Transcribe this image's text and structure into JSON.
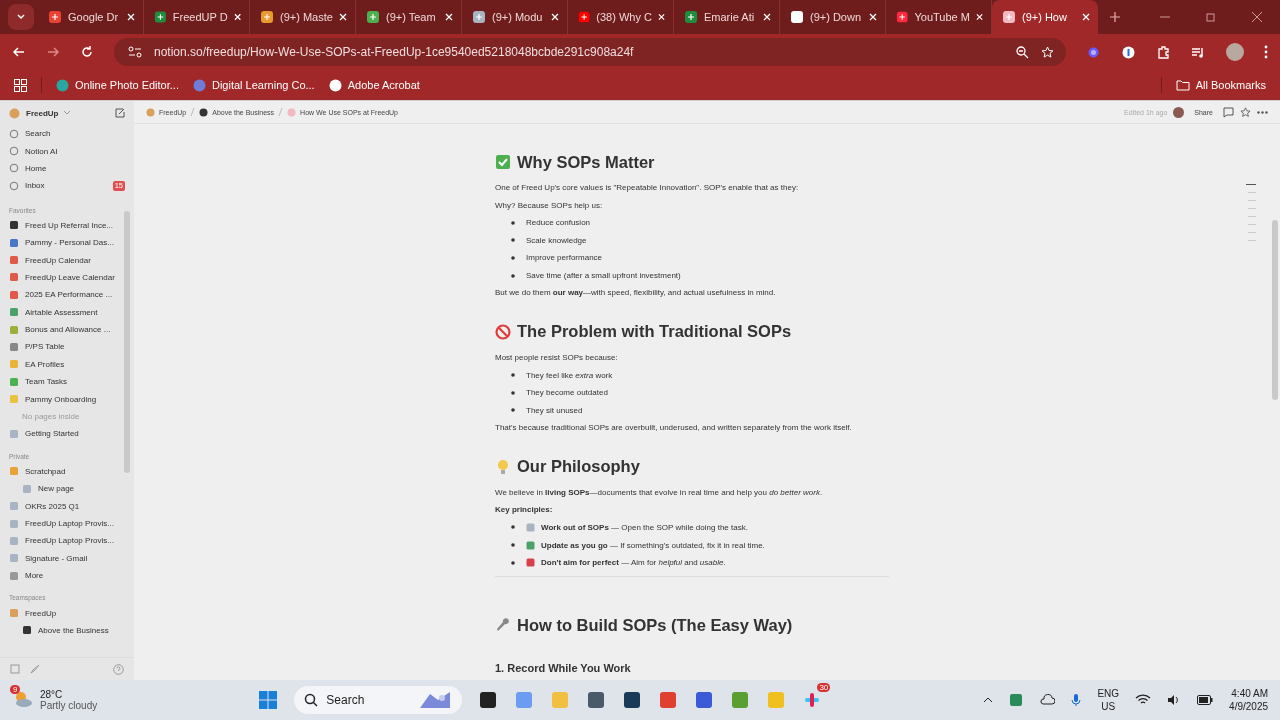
{
  "browser": {
    "tabs": [
      {
        "title": "Google Dr",
        "selected": false
      },
      {
        "title": "FreedUP D",
        "selected": false
      },
      {
        "title": "(9+) Maste",
        "selected": false
      },
      {
        "title": "(9+) Team",
        "selected": false
      },
      {
        "title": "(9+) Modu",
        "selected": false
      },
      {
        "title": "(38) Why C",
        "selected": false
      },
      {
        "title": "Emarie Ati",
        "selected": false
      },
      {
        "title": "(9+) Down",
        "selected": false
      },
      {
        "title": "YouTube M",
        "selected": false
      },
      {
        "title": "(9+) How",
        "selected": true
      }
    ],
    "url": "notion.so/freedup/How-We-Use-SOPs-at-FreedUp-1ce9540ed5218048bcbde291c908a24f",
    "bookmarks": [
      {
        "label": "Online Photo Editor..."
      },
      {
        "label": "Digital Learning Co..."
      },
      {
        "label": "Adobe Acrobat"
      }
    ],
    "all_bookmarks": "All Bookmarks"
  },
  "sidebar": {
    "workspace": "FreedUp",
    "nav": [
      {
        "label": "Search"
      },
      {
        "label": "Notion AI"
      },
      {
        "label": "Home"
      },
      {
        "label": "Inbox",
        "badge": "15"
      }
    ],
    "sections": [
      {
        "title": "Favorites",
        "items": [
          {
            "label": "Freed Up Referral Ince..."
          },
          {
            "label": "Pammy - Personal Das..."
          },
          {
            "label": "FreedUp Calendar"
          },
          {
            "label": "FreedUp Leave Calendar"
          },
          {
            "label": "2025 EA Performance ..."
          },
          {
            "label": "Airtable Assessment"
          },
          {
            "label": "Bonus and Allowance ..."
          },
          {
            "label": "P/PS Table"
          },
          {
            "label": "EA Profiles"
          },
          {
            "label": "Team Tasks"
          },
          {
            "label": "Pammy Onboarding",
            "children": [
              {
                "label": "No pages inside",
                "kind": "empty"
              }
            ]
          },
          {
            "label": "Getting Started"
          }
        ]
      },
      {
        "title": "Private",
        "items": [
          {
            "label": "Scratchpad",
            "children": [
              {
                "label": "New page",
                "kind": "page"
              }
            ]
          },
          {
            "label": "OKRs 2025 Q1"
          },
          {
            "label": "FreedUp Laptop Provis..."
          },
          {
            "label": "FreedUp Laptop Provis..."
          },
          {
            "label": "Signature - Gmail"
          },
          {
            "label": "More"
          }
        ]
      },
      {
        "title": "Teamspaces",
        "items": [
          {
            "label": "FreedUp",
            "children": [
              {
                "label": "Above the Business",
                "kind": "page"
              }
            ]
          }
        ]
      }
    ]
  },
  "header": {
    "breadcrumb": [
      {
        "label": "FreedUp"
      },
      {
        "label": "Above the Business"
      },
      {
        "label": "How We Use SOPs at FreedUp"
      }
    ],
    "edited": "Edited 1h ago",
    "share": "Share"
  },
  "blocks": [
    {
      "kind": "heading",
      "text": "Why SOPs Matter"
    },
    {
      "kind": "para",
      "text": "One of Freed Up's core values is \"Repeatable Innovation\". SOP's enable that as they:"
    },
    {
      "kind": "para",
      "text": "Why? Because SOPs help us:"
    },
    {
      "kind": "bullets",
      "items": [
        {
          "text": "Reduce confusion"
        },
        {
          "text": "Scale knowledge"
        },
        {
          "text": "Improve performance"
        },
        {
          "text": "Save time (after a small upfront investment)"
        }
      ]
    },
    {
      "kind": "para",
      "text": "But we do them **our way**—with speed, flexibility, and actual usefulness in mind."
    },
    {
      "kind": "heading",
      "text": "The Problem with Traditional SOPs"
    },
    {
      "kind": "para",
      "text": "Most people resist SOPs because:"
    },
    {
      "kind": "bullets",
      "items": [
        {
          "text": "They feel like *extra* work"
        },
        {
          "text": "They become outdated"
        },
        {
          "text": "They sit unused"
        }
      ]
    },
    {
      "kind": "para",
      "text": "That's because traditional SOPs are overbuilt, underused, and written separately from the work itself."
    },
    {
      "kind": "heading",
      "text": "Our Philosophy"
    },
    {
      "kind": "para",
      "text": "We believe in **living SOPs**—documents that evolve in real time and help you *do better work*."
    },
    {
      "kind": "label",
      "text": "Key principles:"
    },
    {
      "kind": "bullets",
      "items": [
        {
          "text": "**Work out of SOPs** — Open the SOP while doing the task."
        },
        {
          "text": "**Update as you go** — If something's outdated, fix it in real time."
        },
        {
          "text": "**Don't aim for perfect** — Aim for *helpful* and *usable*."
        }
      ]
    },
    {
      "kind": "divider"
    },
    {
      "kind": "heading",
      "text": "How to Build SOPs (The Easy Way)"
    },
    {
      "kind": "subheading",
      "text": "1. Record While You Work"
    }
  ],
  "taskbar": {
    "weather_badge": "9",
    "temperature": "28°C",
    "weather": "Partly cloudy",
    "search": "Search",
    "app_badge": "30",
    "language": "ENG",
    "region": "US",
    "time": "4:40 AM",
    "date": "4/9/2025"
  }
}
